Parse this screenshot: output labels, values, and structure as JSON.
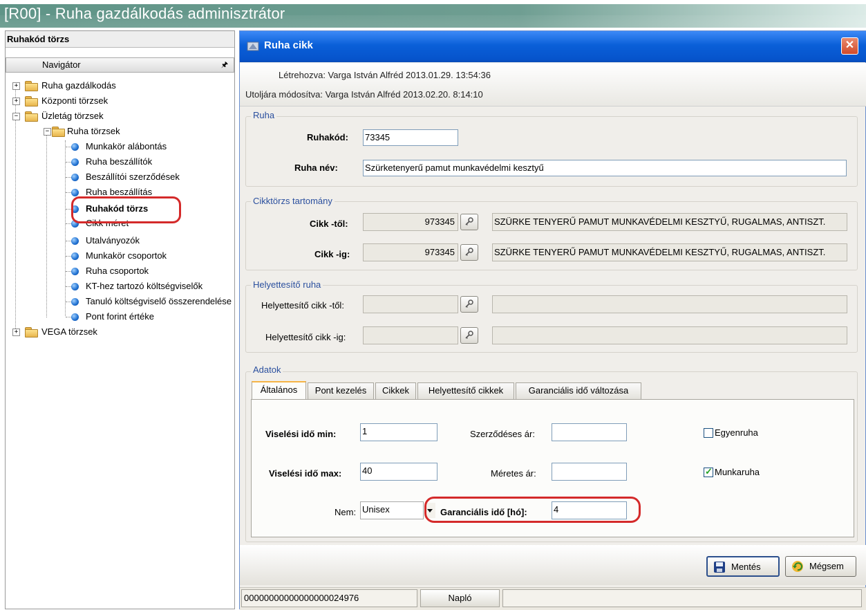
{
  "app": {
    "title": "[R00] - Ruha gazdálkodás adminisztrátor"
  },
  "left": {
    "header": "Ruhakód törzs",
    "navigator": "Navigátor",
    "tree": {
      "roots": [
        "Ruha gazdálkodás",
        "Központi törzsek",
        "Üzletág törzsek"
      ],
      "sub_folder": "Ruha törzsek",
      "items": [
        "Munkakör alábontás",
        "Ruha beszállítók",
        "Beszállítói szerződések",
        "Ruha beszállítás",
        "Ruhakód törzs",
        "Cikk méret",
        "Utalványozók",
        "Munkakör csoportok",
        "Ruha csoportok",
        "KT-hez tartozó költségviselők",
        "Tanuló költségviselő összerendelése",
        "Pont forint értéke"
      ],
      "last_root": "VEGA törzsek"
    }
  },
  "dialog": {
    "title": "Ruha cikk",
    "created": "Létrehozva: Varga István Alfréd 2013.01.29. 13:54:36",
    "modified": "Utoljára módosítva: Varga István Alfréd 2013.02.20. 8:14:10",
    "ruha": {
      "group_title": "Ruha",
      "code_label": "Ruhakód:",
      "code_value": "73345",
      "name_label": "Ruha név:",
      "name_value": "Szürketenyerű pamut munkavédelmi kesztyű"
    },
    "cikk": {
      "group_title": "Cikktörzs tartomány",
      "from_label": "Cikk -től:",
      "from_value": "973345",
      "from_desc": "SZÜRKE TENYERŰ PAMUT MUNKAVÉDELMI KESZTYŰ, RUGALMAS, ANTISZT.",
      "to_label": "Cikk -ig:",
      "to_value": "973345",
      "to_desc": "SZÜRKE TENYERŰ PAMUT MUNKAVÉDELMI KESZTYŰ, RUGALMAS, ANTISZT."
    },
    "helyettesito": {
      "group_title": "Helyettesítő ruha",
      "from_label": "Helyettesítő cikk -től:",
      "to_label": "Helyettesítő cikk -ig:"
    },
    "adatok": {
      "group_title": "Adatok",
      "tabs": [
        "Általános",
        "Pont kezelés",
        "Cikkek",
        "Helyettesítő cikkek",
        "Garanciális idő változása"
      ],
      "active_tab": "Általános",
      "visel_min_label": "Viselési idő min:",
      "visel_min_value": "1",
      "visel_max_label": "Viselési idő max:",
      "visel_max_value": "40",
      "szerz_ar_label": "Szerződéses ár:",
      "szerz_ar_value": "",
      "meretes_ar_label": "Méretes ár:",
      "meretes_ar_value": "",
      "egyenruha_label": "Egyenruha",
      "egyenruha_checked": false,
      "munkaruha_label": "Munkaruha",
      "munkaruha_checked": true,
      "nem_label": "Nem:",
      "nem_value": "Unisex",
      "garancia_label": "Garanciális idő [hó]:",
      "garancia_value": "4"
    },
    "buttons": {
      "save": "Mentés",
      "cancel": "Mégsem"
    },
    "status": {
      "id": "00000000000000000024976",
      "log": "Napló"
    }
  },
  "colors": {
    "title_band": "#6f9e92",
    "dialog_title": "#0a5fd8",
    "highlight": "#d42a2a",
    "group_title": "#2a4f9e"
  }
}
